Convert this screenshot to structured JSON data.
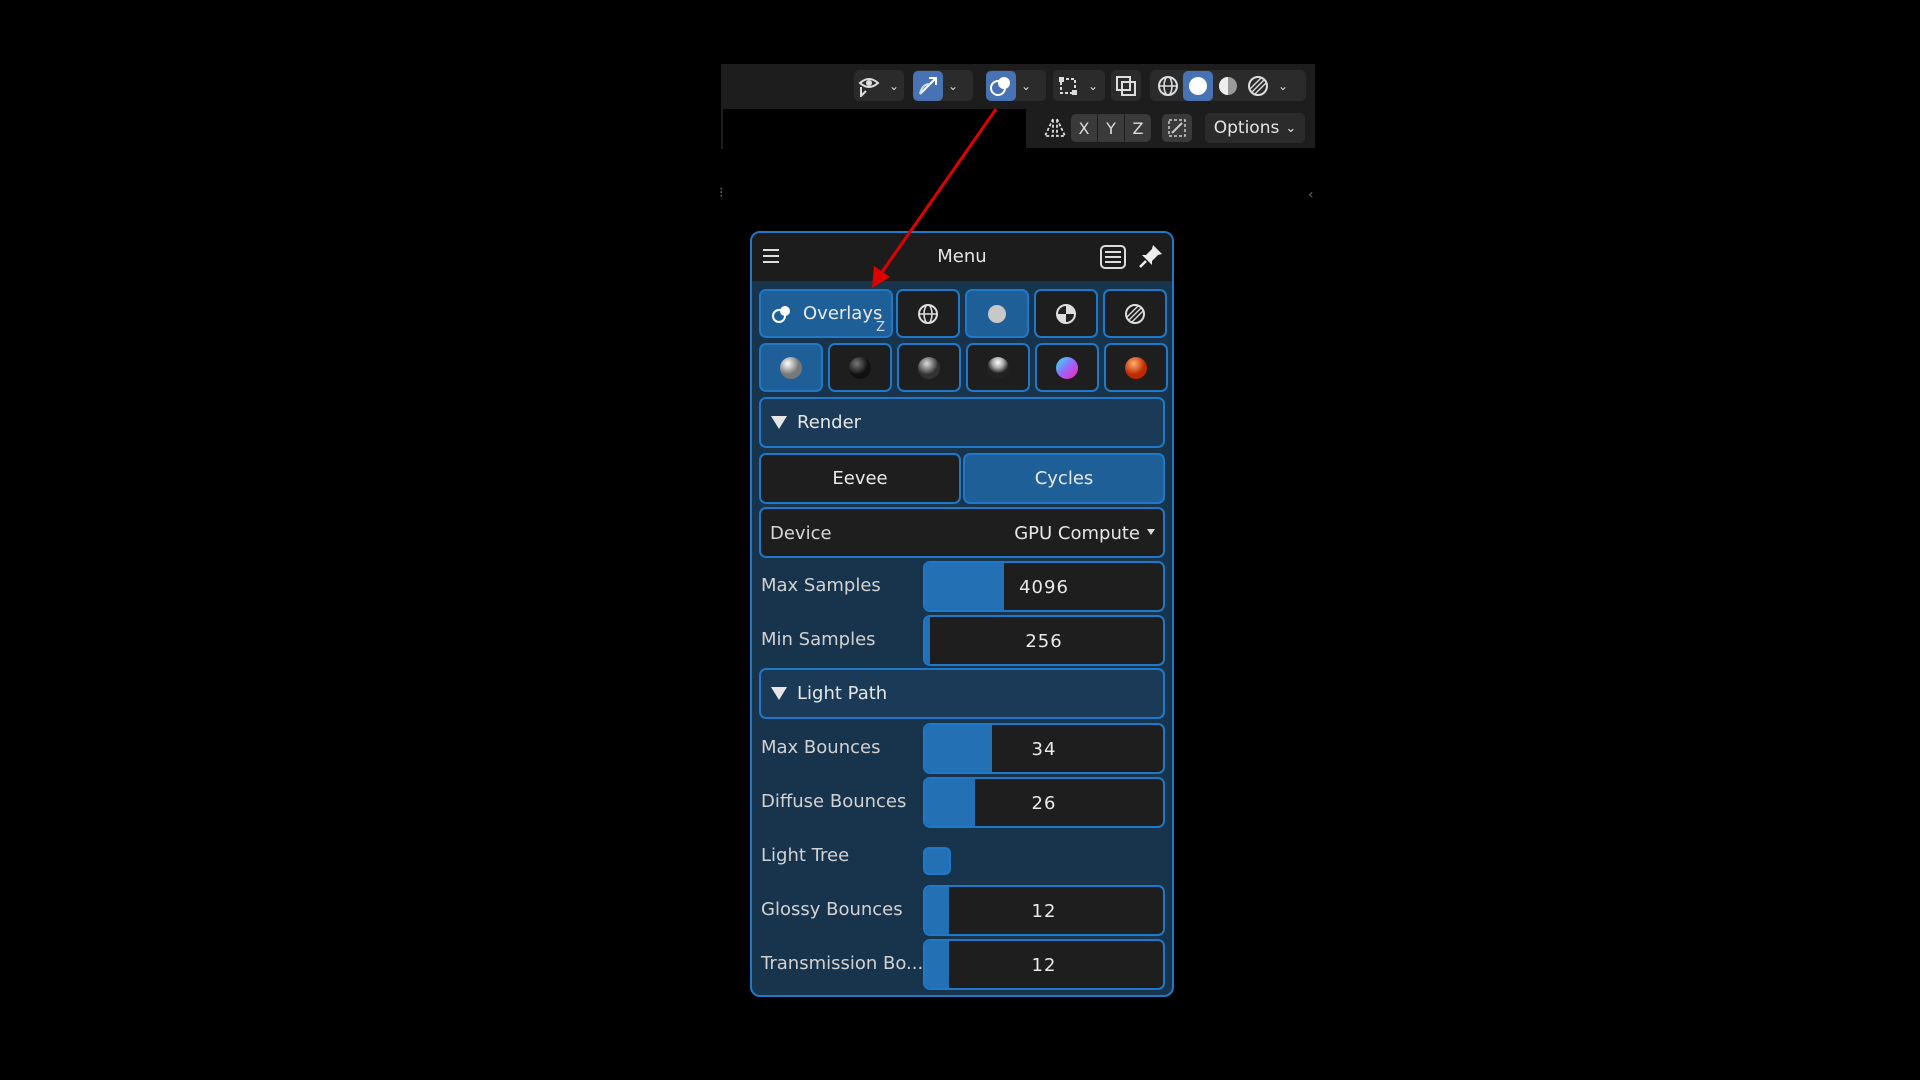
{
  "header": {
    "visibility_icon": "eye-icon",
    "gizmo_icon": "gizmo-icon",
    "overlays_icon": "overlays-icon",
    "selection_icon": "selection-mode-icon",
    "xray_icon": "xray-icon",
    "shading_modes": [
      "wireframe-icon",
      "solid-icon",
      "material-preview-icon",
      "rendered-icon"
    ],
    "active_shading": "solid"
  },
  "mirror": {
    "icon": "mirror-icon",
    "axes": [
      "X",
      "Y",
      "Z"
    ],
    "snap_icon": "auto-merge-icon",
    "options_label": "Options"
  },
  "panel": {
    "title": "Menu",
    "overlays_label": "Overlays",
    "overlays_shortcut": "Z",
    "matcaps": [
      "matcap-light-sphere",
      "matcap-dark-sphere",
      "matcap-gray-sphere",
      "matcap-glossy-sphere",
      "matcap-rainbow-sphere",
      "matcap-orange-sphere"
    ],
    "render_section": "Render",
    "engines": [
      {
        "label": "Eevee",
        "active": false
      },
      {
        "label": "Cycles",
        "active": true
      }
    ],
    "device_label": "Device",
    "device_value": "GPU Compute",
    "max_samples_label": "Max Samples",
    "max_samples_value": "4096",
    "max_samples_fill": 0.33,
    "min_samples_label": "Min Samples",
    "min_samples_value": "256",
    "min_samples_fill": 0.02,
    "light_path_section": "Light Path",
    "max_bounces_label": "Max Bounces",
    "max_bounces_value": "34",
    "max_bounces_fill": 0.28,
    "diffuse_bounces_label": "Diffuse Bounces",
    "diffuse_bounces_value": "26",
    "diffuse_bounces_fill": 0.21,
    "light_tree_label": "Light Tree",
    "light_tree_checked": false,
    "glossy_bounces_label": "Glossy Bounces",
    "glossy_bounces_value": "12",
    "glossy_bounces_fill": 0.1,
    "transmission_bounces_label": "Transmission Bo...",
    "transmission_bounces_value": "12",
    "transmission_bounces_fill": 0.1
  },
  "colors": {
    "accent": "#1f78c8",
    "active": "#4772b3",
    "annotation_arrow": "#e00000"
  }
}
